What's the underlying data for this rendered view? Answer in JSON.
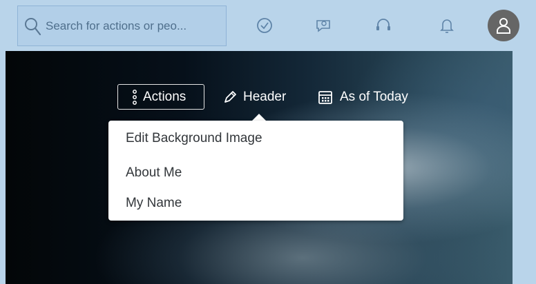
{
  "search": {
    "placeholder": "Search for actions or peo..."
  },
  "topbar_icons": [
    "check-circle-icon",
    "chat-bubble-icon",
    "headset-icon",
    "bell-icon",
    "user-avatar-icon"
  ],
  "toolbar": {
    "actions_label": "Actions",
    "header_label": "Header",
    "as_of_label": "As of Today"
  },
  "menu": {
    "items": [
      {
        "label": "Edit Background Image"
      },
      {
        "label": "About Me"
      },
      {
        "label": "My Name"
      }
    ]
  }
}
